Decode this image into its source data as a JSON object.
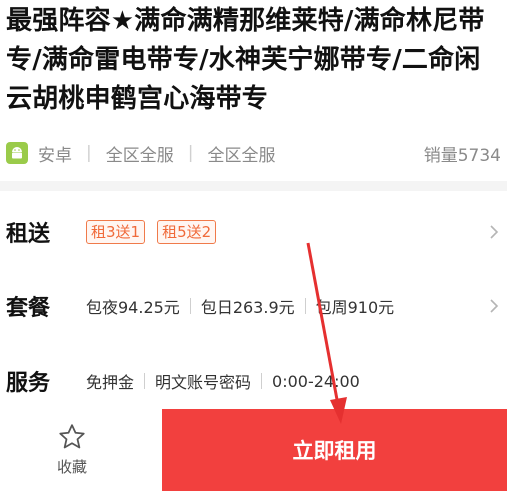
{
  "product": {
    "title": "最强阵容★满命满精那维莱特/满命林尼带专/满命雷电带专/水神芙宁娜带专/二命闲云胡桃申鹤宫心海带专",
    "platform": "安卓",
    "region_1": "全区全服",
    "region_2": "全区全服",
    "sales": "销量5734"
  },
  "rent": {
    "label": "租送",
    "tags": [
      "租3送1",
      "租5送2"
    ]
  },
  "package": {
    "label": "套餐",
    "items": [
      "包夜94.25元",
      "包日263.9元",
      "包周910元"
    ]
  },
  "service": {
    "label": "服务",
    "items": [
      "免押金",
      "明文账号密码",
      "0:00-24:00"
    ]
  },
  "bottom": {
    "favorite_label": "收藏",
    "rent_button": "立即租用"
  },
  "colors": {
    "accent": "#f2403e",
    "tag": "#f06a3a",
    "annotation_arrow": "#e53030"
  }
}
